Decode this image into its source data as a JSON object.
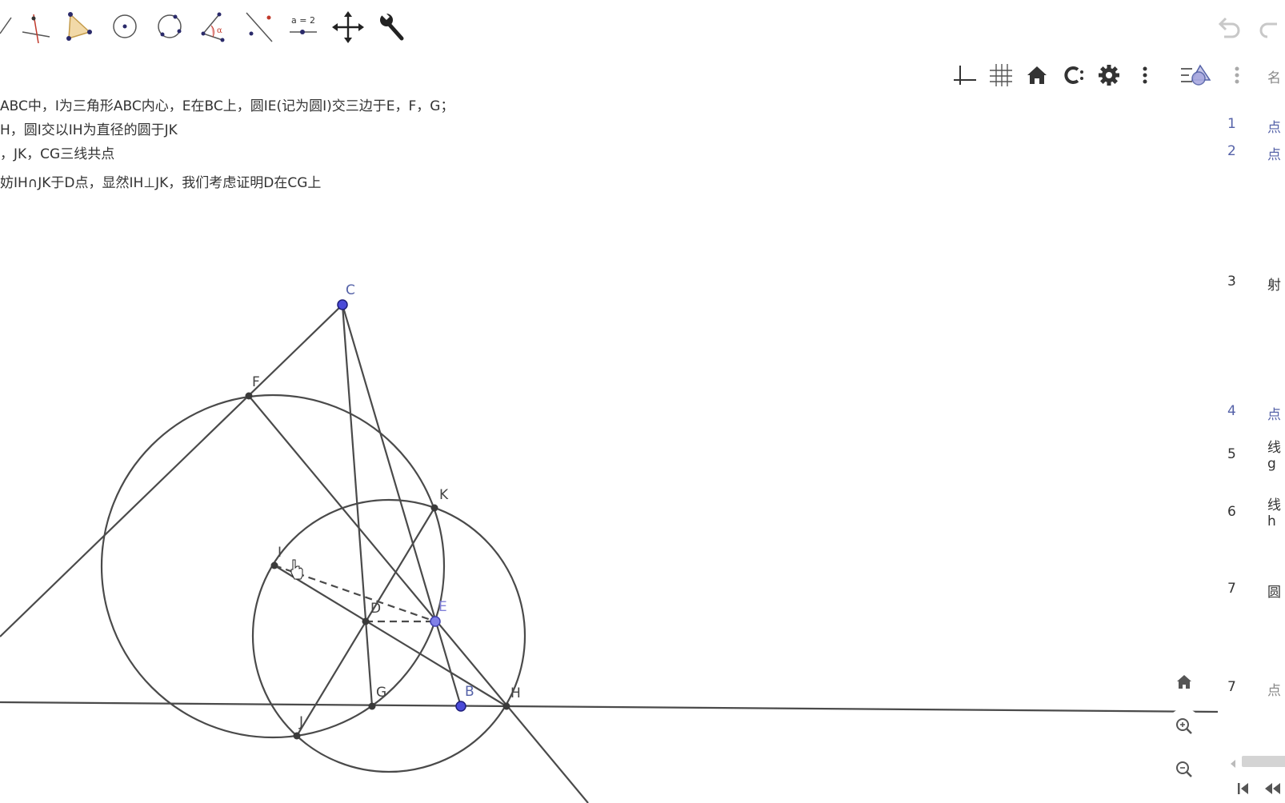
{
  "toolbar": {
    "tools": [
      {
        "icon": "line-tool-icon"
      },
      {
        "icon": "perpendicular-line-icon"
      },
      {
        "icon": "polygon-icon"
      },
      {
        "icon": "circle-center-point-icon"
      },
      {
        "icon": "circle-three-points-icon"
      },
      {
        "icon": "angle-icon"
      },
      {
        "icon": "reflect-icon"
      },
      {
        "icon": "slider-icon",
        "label": "a = 2"
      },
      {
        "icon": "move-view-icon"
      },
      {
        "icon": "wrench-icon"
      }
    ],
    "undo_icon": "undo-icon",
    "redo_icon": "redo-icon"
  },
  "notes": [
    "ABC中，I为三角形ABC内心，E在BC上，圆IE(记为圆I)交三边于E，F，G；",
    "H，圆I交以IH为直径的圆于JK",
    "，JK，CG三线共点",
    "妨IH∩JK于D点，显然IH⊥JK，我们考虑证明D在CG上"
  ],
  "graphics_toolbar": [
    "axes-icon",
    "grid-icon",
    "home-icon",
    "snap-icon",
    "settings-icon",
    "more-vertical-icon",
    "style-bar-toggle-icon"
  ],
  "zoom": {
    "home": "home-view-icon",
    "zoom_in": "zoom-in-icon",
    "zoom_out": "zoom-out-icon"
  },
  "points": {
    "C": {
      "label": "C",
      "free": true
    },
    "F": {
      "label": "F",
      "free": false
    },
    "K": {
      "label": "K",
      "free": false
    },
    "I": {
      "label": "I",
      "free": false
    },
    "D": {
      "label": "D",
      "free": false
    },
    "E": {
      "label": "E",
      "free": true
    },
    "G": {
      "label": "G",
      "free": false
    },
    "B": {
      "label": "B",
      "free": true
    },
    "H": {
      "label": "H",
      "free": false
    },
    "J": {
      "label": "J",
      "free": false
    }
  },
  "colors": {
    "free_point": "#4a4ad8",
    "dependent_point": "#3a3a3a",
    "line": "#4a4a4a",
    "label_blue": "#5562a8"
  },
  "algebra": {
    "header_more_icon": "more-vertical-icon",
    "header_label": "名",
    "rows": [
      {
        "num": "1",
        "text": "点",
        "blue": true
      },
      {
        "num": "2",
        "text": "点",
        "blue": true
      },
      {
        "num": "3",
        "text": "射",
        "blue": false
      },
      {
        "num": "4",
        "text": "点",
        "blue": true
      },
      {
        "num": "5",
        "text": "线",
        "sub": "g",
        "blue": false
      },
      {
        "num": "6",
        "text": "线",
        "sub": "h",
        "blue": false
      },
      {
        "num": "7",
        "text": "圆",
        "blue": false
      },
      {
        "num": "7",
        "text": "点",
        "blue": false
      }
    ],
    "nav_first_icon": "skip-first-icon",
    "nav_prev_icon": "step-back-icon"
  }
}
